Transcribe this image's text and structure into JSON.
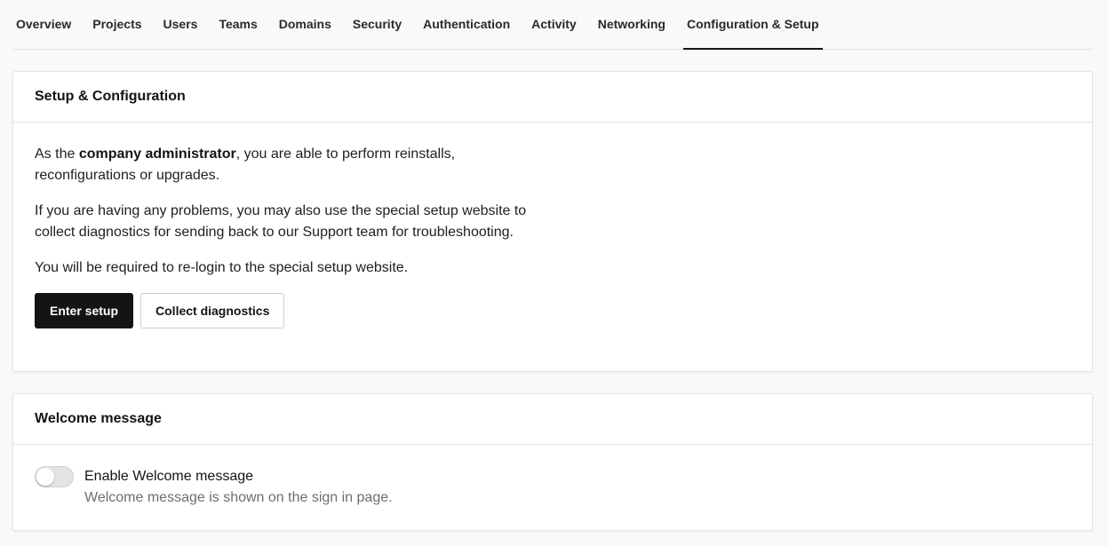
{
  "tabs": [
    {
      "label": "Overview"
    },
    {
      "label": "Projects"
    },
    {
      "label": "Users"
    },
    {
      "label": "Teams"
    },
    {
      "label": "Domains"
    },
    {
      "label": "Security"
    },
    {
      "label": "Authentication"
    },
    {
      "label": "Activity"
    },
    {
      "label": "Networking"
    },
    {
      "label": "Configuration & Setup"
    }
  ],
  "setup": {
    "title": "Setup & Configuration",
    "para1_prefix": "As the ",
    "para1_bold": "company administrator",
    "para1_suffix": ", you are able to perform reinstalls, reconfigurations or upgrades.",
    "para2": "If you are having any problems, you may also use the special setup website to collect diagnostics for sending back to our Support team for troubleshooting.",
    "para3": "You will be required to re-login to the special setup website.",
    "enter_button": "Enter setup",
    "diagnostics_button": "Collect diagnostics"
  },
  "welcome": {
    "title": "Welcome message",
    "toggle_label": "Enable Welcome message",
    "toggle_desc": "Welcome message is shown on the sign in page.",
    "enabled": false
  }
}
